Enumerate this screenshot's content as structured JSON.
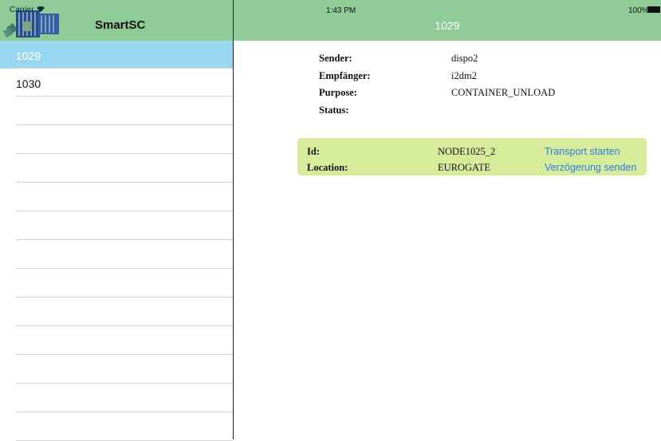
{
  "status": {
    "carrier": "Carrier",
    "time": "1:43 PM",
    "battery": "100%"
  },
  "app": {
    "title": "SmartSC"
  },
  "detail": {
    "title": "1029",
    "fields": [
      {
        "label": "Sender:",
        "value": "dispo2"
      },
      {
        "label": "Empfänger:",
        "value": "i2dm2"
      },
      {
        "label": "Purpose:",
        "value": "CONTAINER_UNLOAD"
      },
      {
        "label": "Status:",
        "value": ""
      }
    ],
    "node": {
      "id_label": "Id:",
      "id_value": "NODE1025_2",
      "location_label": "Location:",
      "location_value": "EUROGATE",
      "start_label": "Transport starten",
      "delay_label": "Verzögerung senden"
    }
  },
  "list": {
    "items": [
      {
        "label": "1029",
        "selected": true
      },
      {
        "label": "1030",
        "selected": false
      },
      {
        "label": ""
      },
      {
        "label": ""
      },
      {
        "label": ""
      },
      {
        "label": ""
      },
      {
        "label": ""
      },
      {
        "label": ""
      },
      {
        "label": ""
      },
      {
        "label": ""
      },
      {
        "label": ""
      },
      {
        "label": ""
      },
      {
        "label": ""
      },
      {
        "label": ""
      }
    ]
  },
  "colors": {
    "header": "#8ecb96",
    "selected": "#99d7f0",
    "card": "#d6ec9a",
    "link": "#2c7de0"
  }
}
